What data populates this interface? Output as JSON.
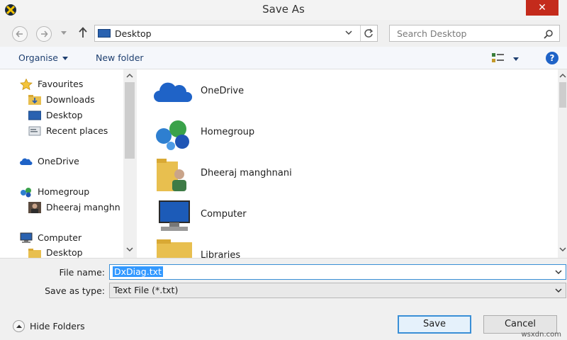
{
  "window": {
    "title": "Save As",
    "close_glyph": "✕"
  },
  "address_bar": {
    "location": "Desktop",
    "search_placeholder": "Search Desktop"
  },
  "toolbar": {
    "organise_label": "Organise",
    "new_folder_label": "New folder",
    "help_glyph": "?"
  },
  "nav_pane": {
    "items": [
      {
        "label": "Favourites",
        "icon": "star-icon"
      },
      {
        "label": "Downloads",
        "icon": "downloads-folder-icon"
      },
      {
        "label": "Desktop",
        "icon": "desktop-icon"
      },
      {
        "label": "Recent places",
        "icon": "recent-places-icon"
      },
      {
        "label": "OneDrive",
        "icon": "onedrive-icon"
      },
      {
        "label": "Homegroup",
        "icon": "homegroup-icon"
      },
      {
        "label": "Dheeraj manghn",
        "icon": "user-avatar-icon"
      },
      {
        "label": "Computer",
        "icon": "computer-icon"
      },
      {
        "label": "Desktop",
        "icon": "desktop-folder-icon"
      }
    ]
  },
  "main_pane": {
    "items": [
      {
        "label": "OneDrive",
        "icon": "onedrive-icon"
      },
      {
        "label": "Homegroup",
        "icon": "homegroup-icon"
      },
      {
        "label": "Dheeraj manghnani",
        "icon": "user-folder-icon"
      },
      {
        "label": "Computer",
        "icon": "computer-icon"
      },
      {
        "label": "Libraries",
        "icon": "libraries-icon"
      }
    ]
  },
  "form": {
    "file_name_label": "File name:",
    "file_name_value": "DxDiag.txt",
    "save_type_label": "Save as type:",
    "save_type_value": "Text File (*.txt)"
  },
  "footer": {
    "hide_folders_label": "Hide Folders",
    "save_label": "Save",
    "cancel_label": "Cancel",
    "watermark": "wsxdn.com"
  },
  "colors": {
    "accent": "#3a8fd6",
    "close_red": "#c42b1c",
    "selection": "#3399ff",
    "link_text": "#1e3f70"
  }
}
